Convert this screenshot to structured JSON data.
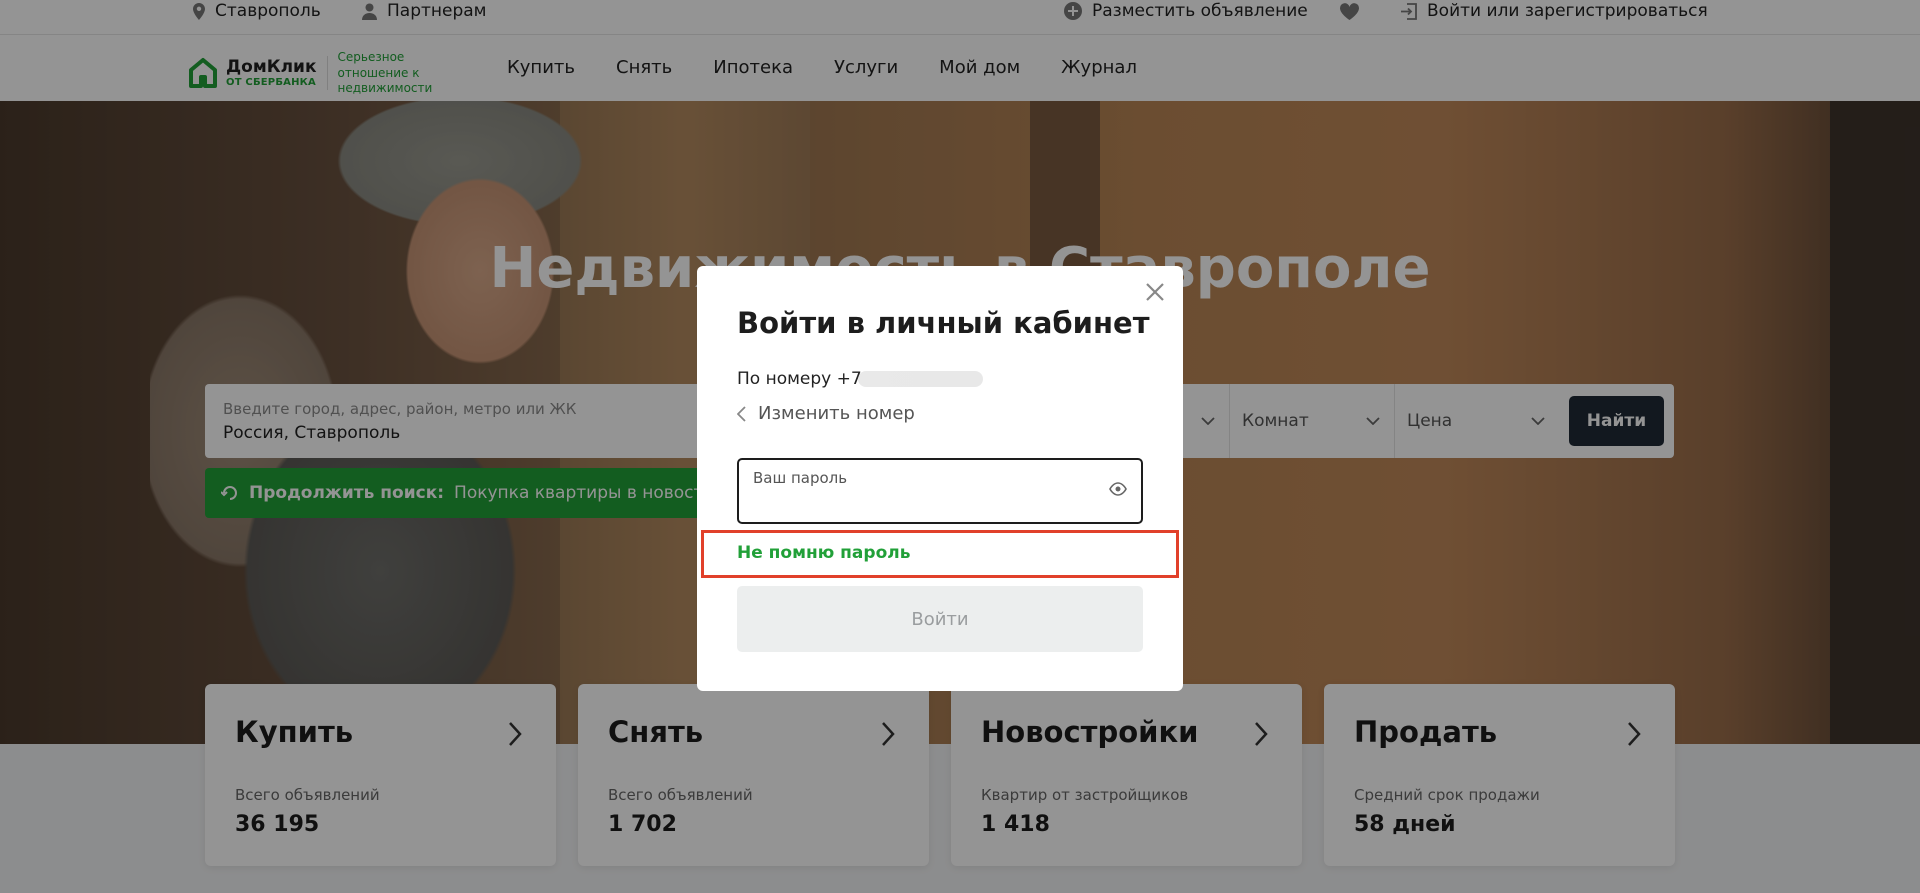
{
  "topbar": {
    "city": "Ставрополь",
    "partners": "Партнерам",
    "post_ad": "Разместить объявление",
    "login": "Войти или зарегистрироваться"
  },
  "header": {
    "logo_name": "ДомКлик",
    "logo_sub": "ОТ СБЕРБАНКА",
    "logo_tagline": "Серьезное отношение к недвижимости",
    "nav": [
      "Купить",
      "Снять",
      "Ипотека",
      "Услуги",
      "Мой дом",
      "Журнал"
    ]
  },
  "hero": {
    "title": "Недвижимость в Ставрополе"
  },
  "search": {
    "placeholder": "Введите город, адрес, район, метро или ЖК",
    "value": "Россия, Ставрополь",
    "type_label": "",
    "rooms_label": "Комнат",
    "price_label": "Цена",
    "button": "Найти"
  },
  "continue_search": {
    "label": "Продолжить поиск:",
    "value": "Покупка квартиры в новостройке"
  },
  "cards": [
    {
      "title": "Купить",
      "subtitle": "Всего объявлений",
      "value": "36 195"
    },
    {
      "title": "Снять",
      "subtitle": "Всего объявлений",
      "value": "1 702"
    },
    {
      "title": "Новостройки",
      "subtitle": "Квартир от застройщиков",
      "value": "1 418"
    },
    {
      "title": "Продать",
      "subtitle": "Средний срок продажи",
      "value": "58 дней"
    }
  ],
  "modal": {
    "title": "Войти в личный кабинет",
    "phone_prefix": "По номеру +7",
    "change_number": "Изменить номер",
    "password_label": "Ваш пароль",
    "forgot_password": "Не помню пароль",
    "login_button": "Войти"
  },
  "colors": {
    "brand_green": "#21a038",
    "highlight_red": "#e1402a",
    "dark_button": "#1f2a36"
  }
}
